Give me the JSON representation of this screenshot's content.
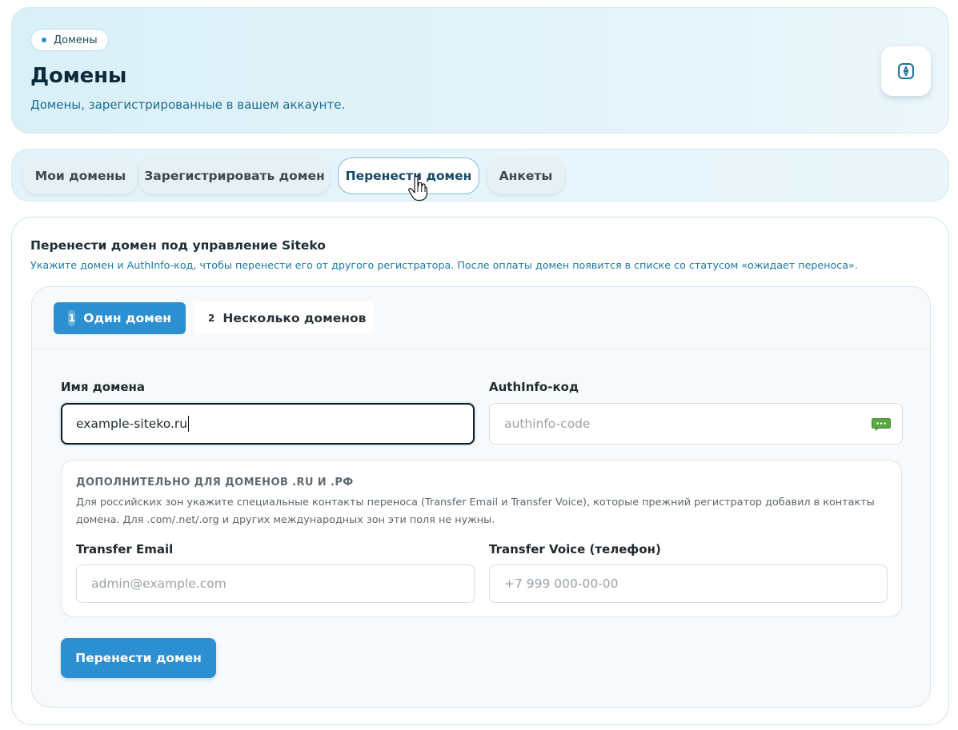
{
  "header": {
    "breadcrumb": "Домены",
    "title": "Домены",
    "subtitle": "Домены, зарегистрированные в вашем аккаунте.",
    "action_icon": "compass-icon"
  },
  "tabs": [
    {
      "label": "Мои домены",
      "active": false
    },
    {
      "label": "Зарегистрировать домен",
      "active": false
    },
    {
      "label": "Перенести домен",
      "active": true
    },
    {
      "label": "Анкеты",
      "active": false
    }
  ],
  "transfer": {
    "title": "Перенести домен под управление Siteko",
    "description": "Укажите домен и AuthInfo-код, чтобы перенести его от другого регистратора. После оплаты домен появится в списке со статусом «ожидает переноса».",
    "steps": [
      {
        "number": "1",
        "label": "Один домен",
        "active": true
      },
      {
        "number": "2",
        "label": "Несколько доменов",
        "active": false
      }
    ],
    "domain_label": "Имя домена",
    "domain_value": "example-siteko.ru",
    "authinfo_label": "AuthInfo-код",
    "authinfo_placeholder": "authinfo-code",
    "authinfo_icon": "password-manager-icon",
    "extra": {
      "title": "ДОПОЛНИТЕЛЬНО ДЛЯ ДОМЕНОВ .RU И .РФ",
      "description": "Для российских зон укажите специальные контакты переноса (Transfer Email и Transfer Voice), которые прежний регистратор добавил в контакты домена. Для .com/.net/.org и других международных зон эти поля не нужны.",
      "email_label": "Transfer Email",
      "email_placeholder": "admin@example.com",
      "voice_label": "Transfer Voice (телефон)",
      "voice_placeholder": "+7 999 000-00-00"
    },
    "submit_label": "Перенести домен"
  },
  "colors": {
    "accent": "#2b8fd1",
    "link_text": "#1b7aa7",
    "header_bg": "#daf0f8"
  }
}
